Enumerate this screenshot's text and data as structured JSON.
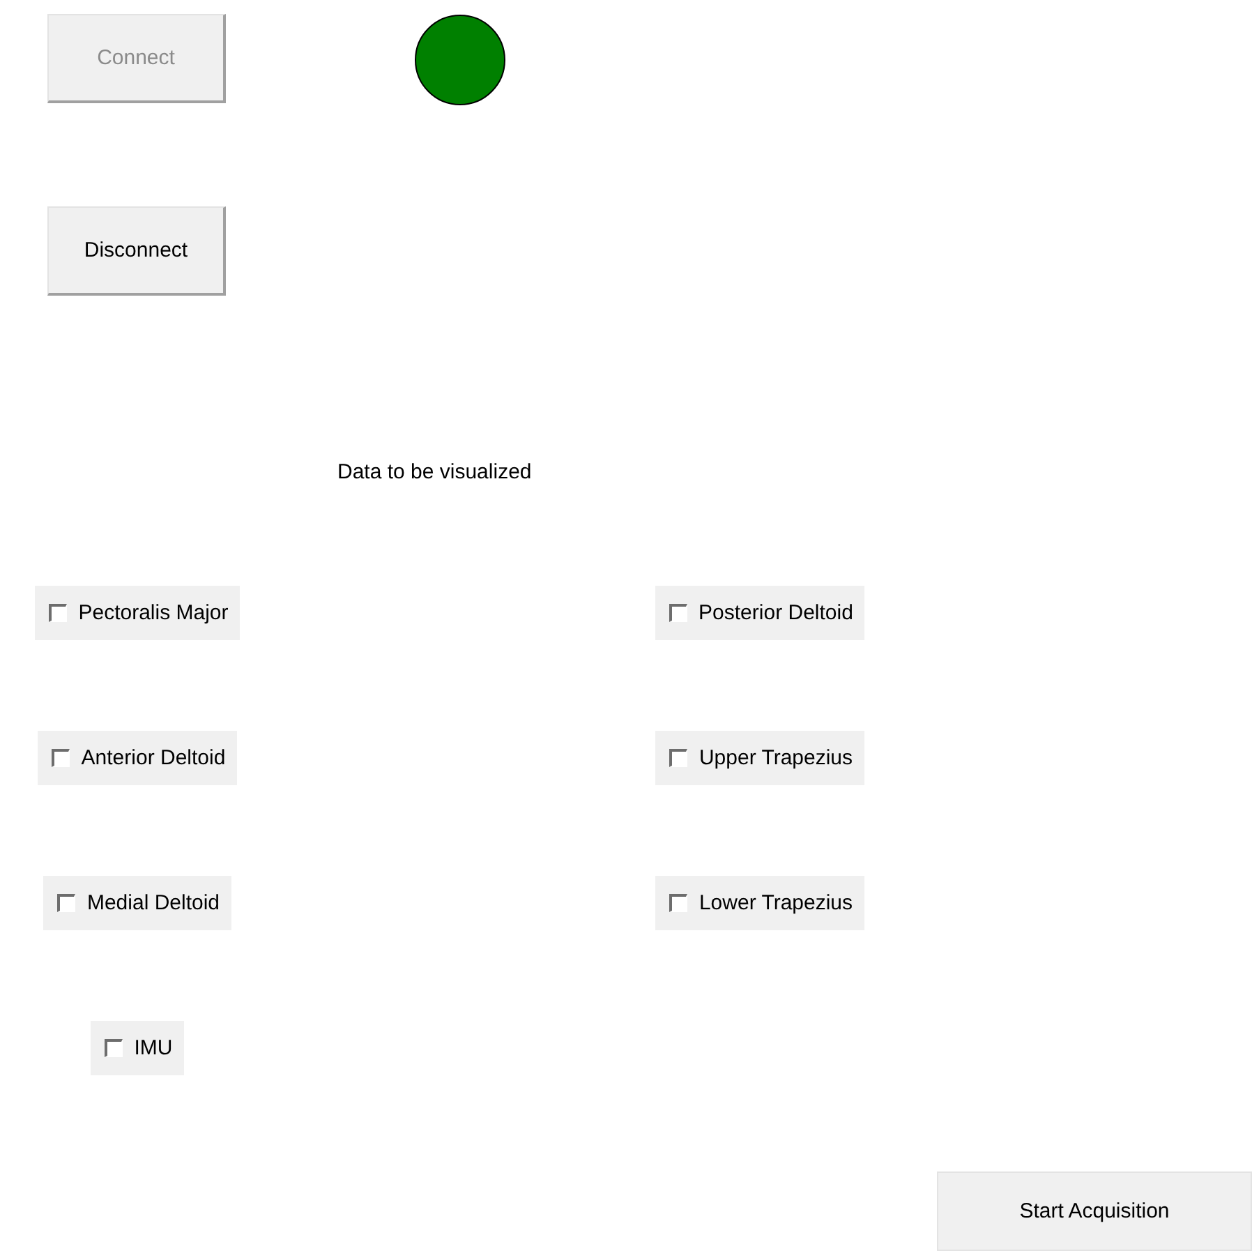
{
  "connect_button": {
    "label": "Connect",
    "disabled": true
  },
  "status_indicator": {
    "color": "#008000"
  },
  "disconnect_button": {
    "label": "Disconnect",
    "disabled": false
  },
  "section_label": "Data to be visualized",
  "checkboxes": [
    {
      "label": "Pectoralis Major",
      "checked": false
    },
    {
      "label": "Posterior Deltoid",
      "checked": false
    },
    {
      "label": "Anterior Deltoid",
      "checked": false
    },
    {
      "label": "Upper Trapezius",
      "checked": false
    },
    {
      "label": "Medial Deltoid",
      "checked": false
    },
    {
      "label": "Lower Trapezius",
      "checked": false
    },
    {
      "label": "IMU",
      "checked": false
    }
  ],
  "start_button": {
    "label": "Start Acquisition"
  }
}
